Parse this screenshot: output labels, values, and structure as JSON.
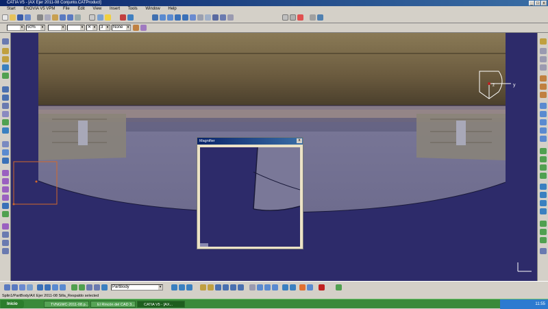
{
  "window": {
    "title": "CATIA V5 - [AX Ejer 2011-08 Conjunto.CATProduct]",
    "controls": [
      "_",
      "□",
      "x"
    ]
  },
  "menu": [
    "Start",
    "ENOVIA V5 VPM",
    "File",
    "Edit",
    "View",
    "Insert",
    "Tools",
    "Window",
    "Help"
  ],
  "toolbar2": {
    "color_value": "",
    "transparency_value": "50%",
    "thickness_value": "",
    "linetype_value": "",
    "point_value": "3",
    "layer_value": "None"
  },
  "bottom_toolbar": {
    "body_select_value": "PartBody"
  },
  "compass": {
    "axis_y": "y",
    "axis_z": "z"
  },
  "magnifier": {
    "title": "Magnifier",
    "close": "x"
  },
  "status": {
    "text": "Splin1/PartBody/AX Ejer 2011-08 Silla_Respaldo selected"
  },
  "taskbar": {
    "start_label": "Inicio",
    "tasks": [
      {
        "label": "TVNGWC-2011-08.p..."
      },
      {
        "label": "El Rincón del CAD 3..."
      },
      {
        "label": "CATIA V5 - [AX..."
      }
    ],
    "clock": "11:55"
  },
  "colors": {
    "viewport_bg": "#2d2b6a",
    "title_bar": "#0a246a",
    "taskbar": "#3a8a3a",
    "selection": "#d46a2a"
  }
}
